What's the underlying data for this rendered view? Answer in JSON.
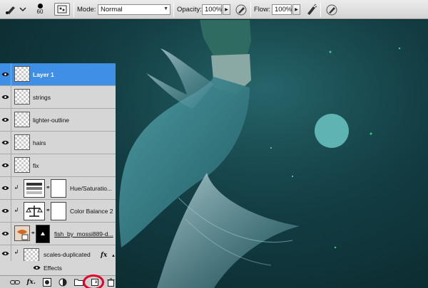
{
  "options_bar": {
    "brush_size": "60",
    "mode_label": "Mode:",
    "mode_value": "Normal",
    "opacity_label": "Opacity:",
    "opacity_value": "100%",
    "flow_label": "Flow:",
    "flow_value": "100%"
  },
  "layers": [
    {
      "name": "Layer 1",
      "selected": true,
      "kind": "pixel"
    },
    {
      "name": "strings",
      "kind": "pixel"
    },
    {
      "name": "lighter-outline",
      "kind": "pixel"
    },
    {
      "name": "hairs",
      "kind": "pixel"
    },
    {
      "name": "fix",
      "kind": "pixel"
    },
    {
      "name": "Hue/Saturatio...",
      "kind": "adjustment-hue"
    },
    {
      "name": "Color Balance 2",
      "kind": "adjustment-balance"
    },
    {
      "name": "fish_by_mossi889-d...",
      "kind": "smart-object"
    },
    {
      "name": "scales-duplicated",
      "kind": "pixel",
      "fx": "fx"
    }
  ],
  "effects_label": "Effects",
  "colors": {
    "selected_row": "#3f8fe6",
    "panel_bg": "#d6d6d6",
    "canvas_bg": "#123d43",
    "swatch_circle": "#5fb3b3",
    "highlight_ring": "#e4002b"
  },
  "icons": {
    "visibility": "eye-icon",
    "link": "link-layers-icon",
    "fx": "add-layer-style-icon",
    "mask": "add-mask-icon",
    "adjustment": "new-adjustment-layer-icon",
    "group": "new-group-icon",
    "new_layer": "new-layer-icon",
    "trash": "delete-layer-icon"
  }
}
